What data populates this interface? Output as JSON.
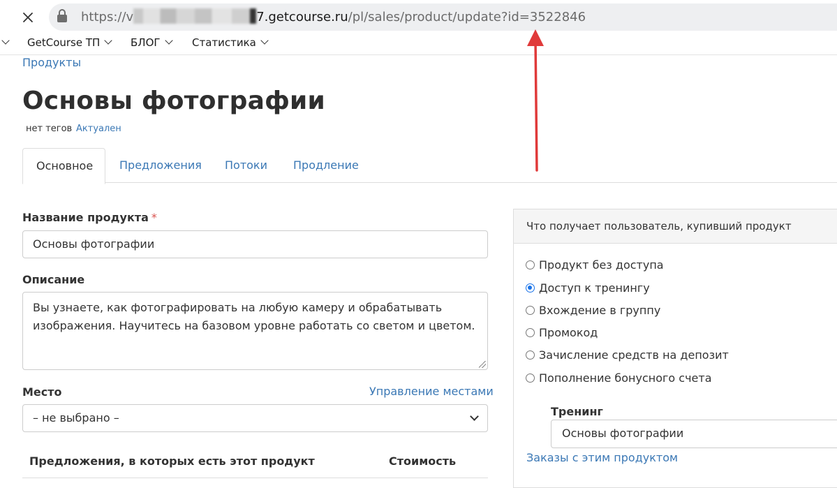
{
  "browser": {
    "url_scheme": "https://",
    "url_blurred_part": "v",
    "url_domain": "7.getcourse.ru",
    "url_path": "/pl/sales/product/update?id=3522846"
  },
  "bookmarks": [
    {
      "label": "GetCourse ТП"
    },
    {
      "label": "БЛОГ"
    },
    {
      "label": "Статистика"
    }
  ],
  "breadcrumb": {
    "label": "Продукты"
  },
  "product": {
    "title": "Основы фотографии",
    "tags": "нет тегов",
    "status": "Актуален"
  },
  "tabs": [
    {
      "label": "Основное",
      "active": true
    },
    {
      "label": "Предложения"
    },
    {
      "label": "Потоки"
    },
    {
      "label": "Продление"
    }
  ],
  "form": {
    "name_label": "Название продукта",
    "name_required": "*",
    "name_value": "Основы фотографии",
    "description_label": "Описание",
    "description_value": "Вы узнаете, как фотографировать на любую камеру и обрабатывать изображения. Научитесь на базовом уровне работать со светом и цветом.",
    "place_label": "Место",
    "place_manage": "Управление местами",
    "place_value": "– не выбрано –"
  },
  "offers_table": {
    "columns": [
      "Предложения, в которых есть этот продукт",
      "Стоимость"
    ]
  },
  "panel": {
    "title": "Что получает пользователь, купивший продукт",
    "options": [
      {
        "label": "Продукт без доступа",
        "selected": false
      },
      {
        "label": "Доступ к тренингу",
        "selected": true
      },
      {
        "label": "Вхождение в группу",
        "selected": false
      },
      {
        "label": "Промокод",
        "selected": false
      },
      {
        "label": "Зачисление средств на депозит",
        "selected": false
      },
      {
        "label": "Пополнение бонусного счета",
        "selected": false
      }
    ],
    "training_label": "Тренинг",
    "training_value": "Основы фотографии",
    "orders_link": "Заказы с этим продуктом"
  },
  "colors": {
    "link": "#3b78b5",
    "radio_selected": "#1a73e8",
    "arrow": "#e03a3a",
    "required": "#d9534f"
  }
}
